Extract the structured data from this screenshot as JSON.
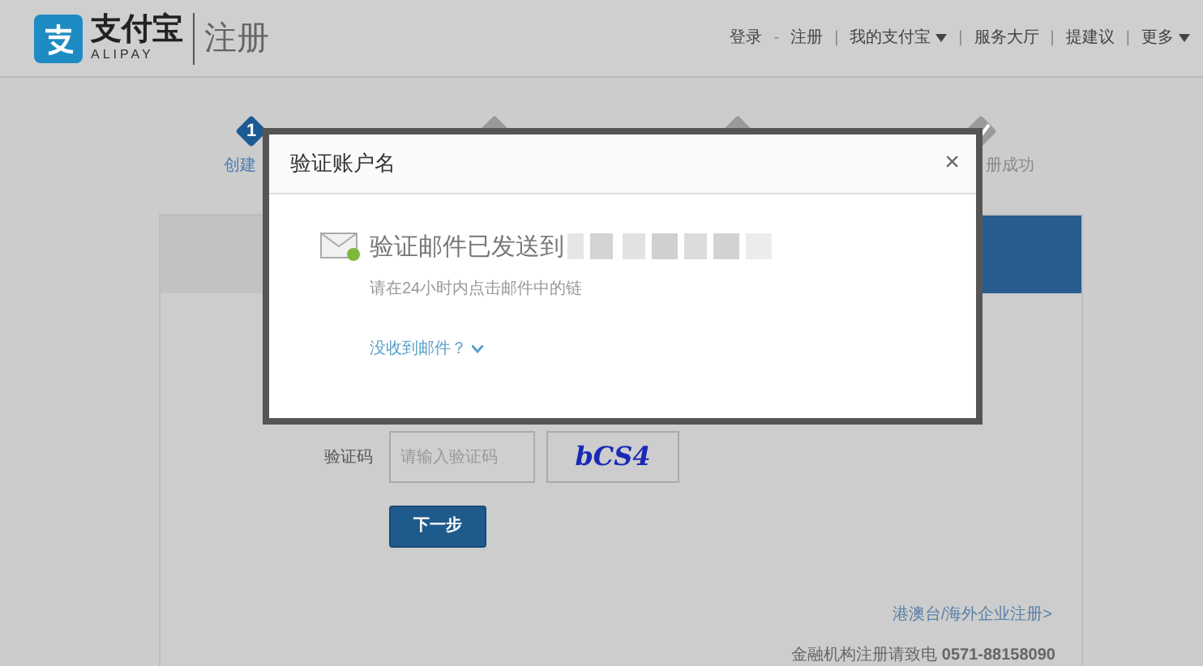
{
  "header": {
    "logo_text": "支付宝",
    "logo_subtext": "ALIPAY",
    "page_title": "注册",
    "nav": [
      {
        "kind": "link",
        "label": "登录"
      },
      {
        "kind": "text",
        "label": "-"
      },
      {
        "kind": "link",
        "label": "注册"
      },
      {
        "kind": "text",
        "label": "|"
      },
      {
        "kind": "menu",
        "label": "我的支付宝"
      },
      {
        "kind": "text",
        "label": "|"
      },
      {
        "kind": "link",
        "label": "服务大厅"
      },
      {
        "kind": "text",
        "label": "|"
      },
      {
        "kind": "link",
        "label": "提建议"
      },
      {
        "kind": "text",
        "label": "|"
      },
      {
        "kind": "menu",
        "label": "更多"
      }
    ]
  },
  "steps": [
    {
      "kind": "number",
      "number": "1",
      "label": "创建",
      "active": true
    },
    {
      "kind": "blank",
      "active": false
    },
    {
      "kind": "blank",
      "active": false
    },
    {
      "kind": "check",
      "label": "册成功",
      "active": false
    }
  ],
  "form": {
    "captcha_label": "验证码",
    "captcha_placeholder": "请输入验证码",
    "captcha_code": "bCS4",
    "next_button": "下一步"
  },
  "footer": {
    "link": "港澳台/海外企业注册>",
    "phone": "金融机构注册请致电 **0571-88158090**"
  },
  "dialog": {
    "title": "验证账户名",
    "close": "×",
    "message": "验证邮件已发送到",
    "hint": "请在24小时内点击邮件中的链",
    "link": "没收到邮件？"
  }
}
